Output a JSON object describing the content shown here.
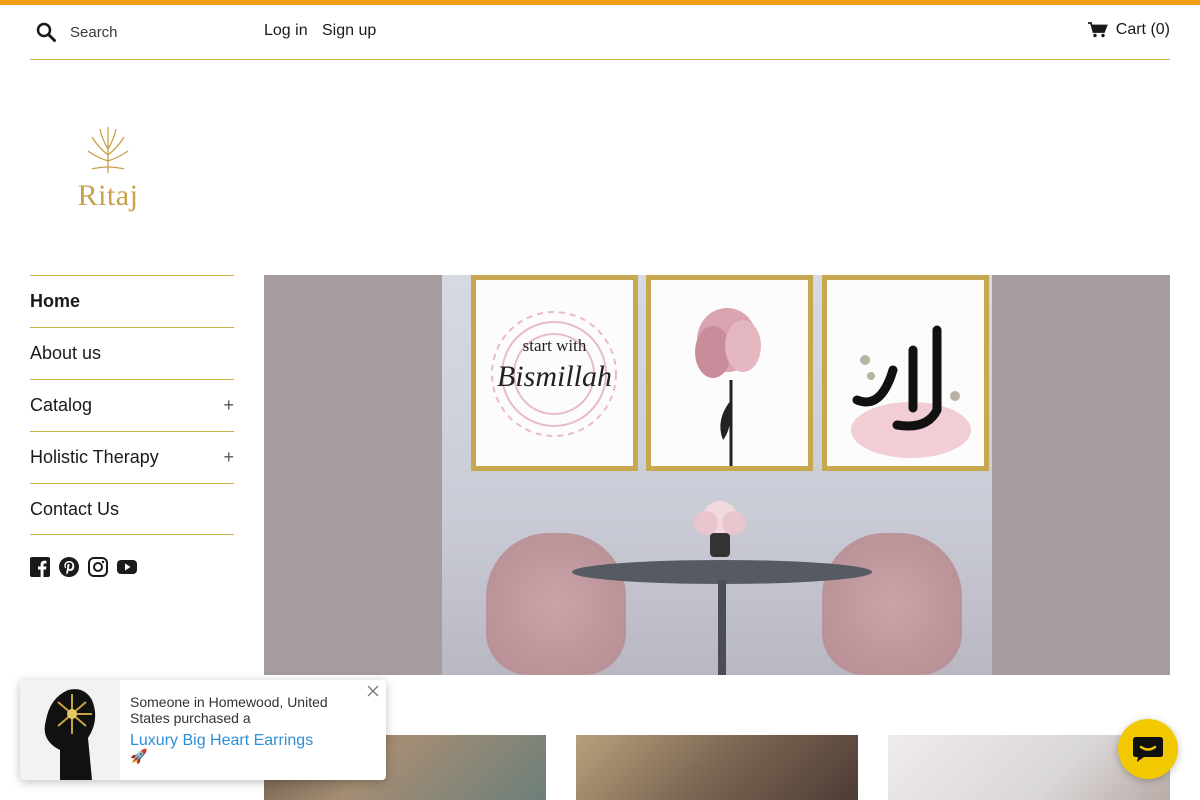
{
  "colors": {
    "accent": "#f29c11",
    "divider": "#c8b24a",
    "logo": "#c8a24a",
    "chat": "#f2c800",
    "link": "#2d8fd5"
  },
  "header": {
    "search_placeholder": "Search",
    "login_label": "Log in",
    "signup_label": "Sign up",
    "cart_label": "Cart (0)"
  },
  "logo": {
    "text": "Ritaj"
  },
  "sidebar": {
    "items": [
      {
        "label": "Home",
        "active": true
      },
      {
        "label": "About us"
      },
      {
        "label": "Catalog",
        "expand": "+"
      },
      {
        "label": "Holistic Therapy",
        "expand": "+"
      },
      {
        "label": "Contact Us"
      }
    ],
    "social_icons": [
      "facebook-icon",
      "pinterest-icon",
      "instagram-icon",
      "youtube-icon"
    ]
  },
  "hero": {
    "art1_line1": "start with",
    "art1_line2": "Bismillah"
  },
  "popup": {
    "message": "Someone in Homewood, United States purchased a",
    "product": "Luxury Big Heart Earrings",
    "icon": "🚀"
  }
}
